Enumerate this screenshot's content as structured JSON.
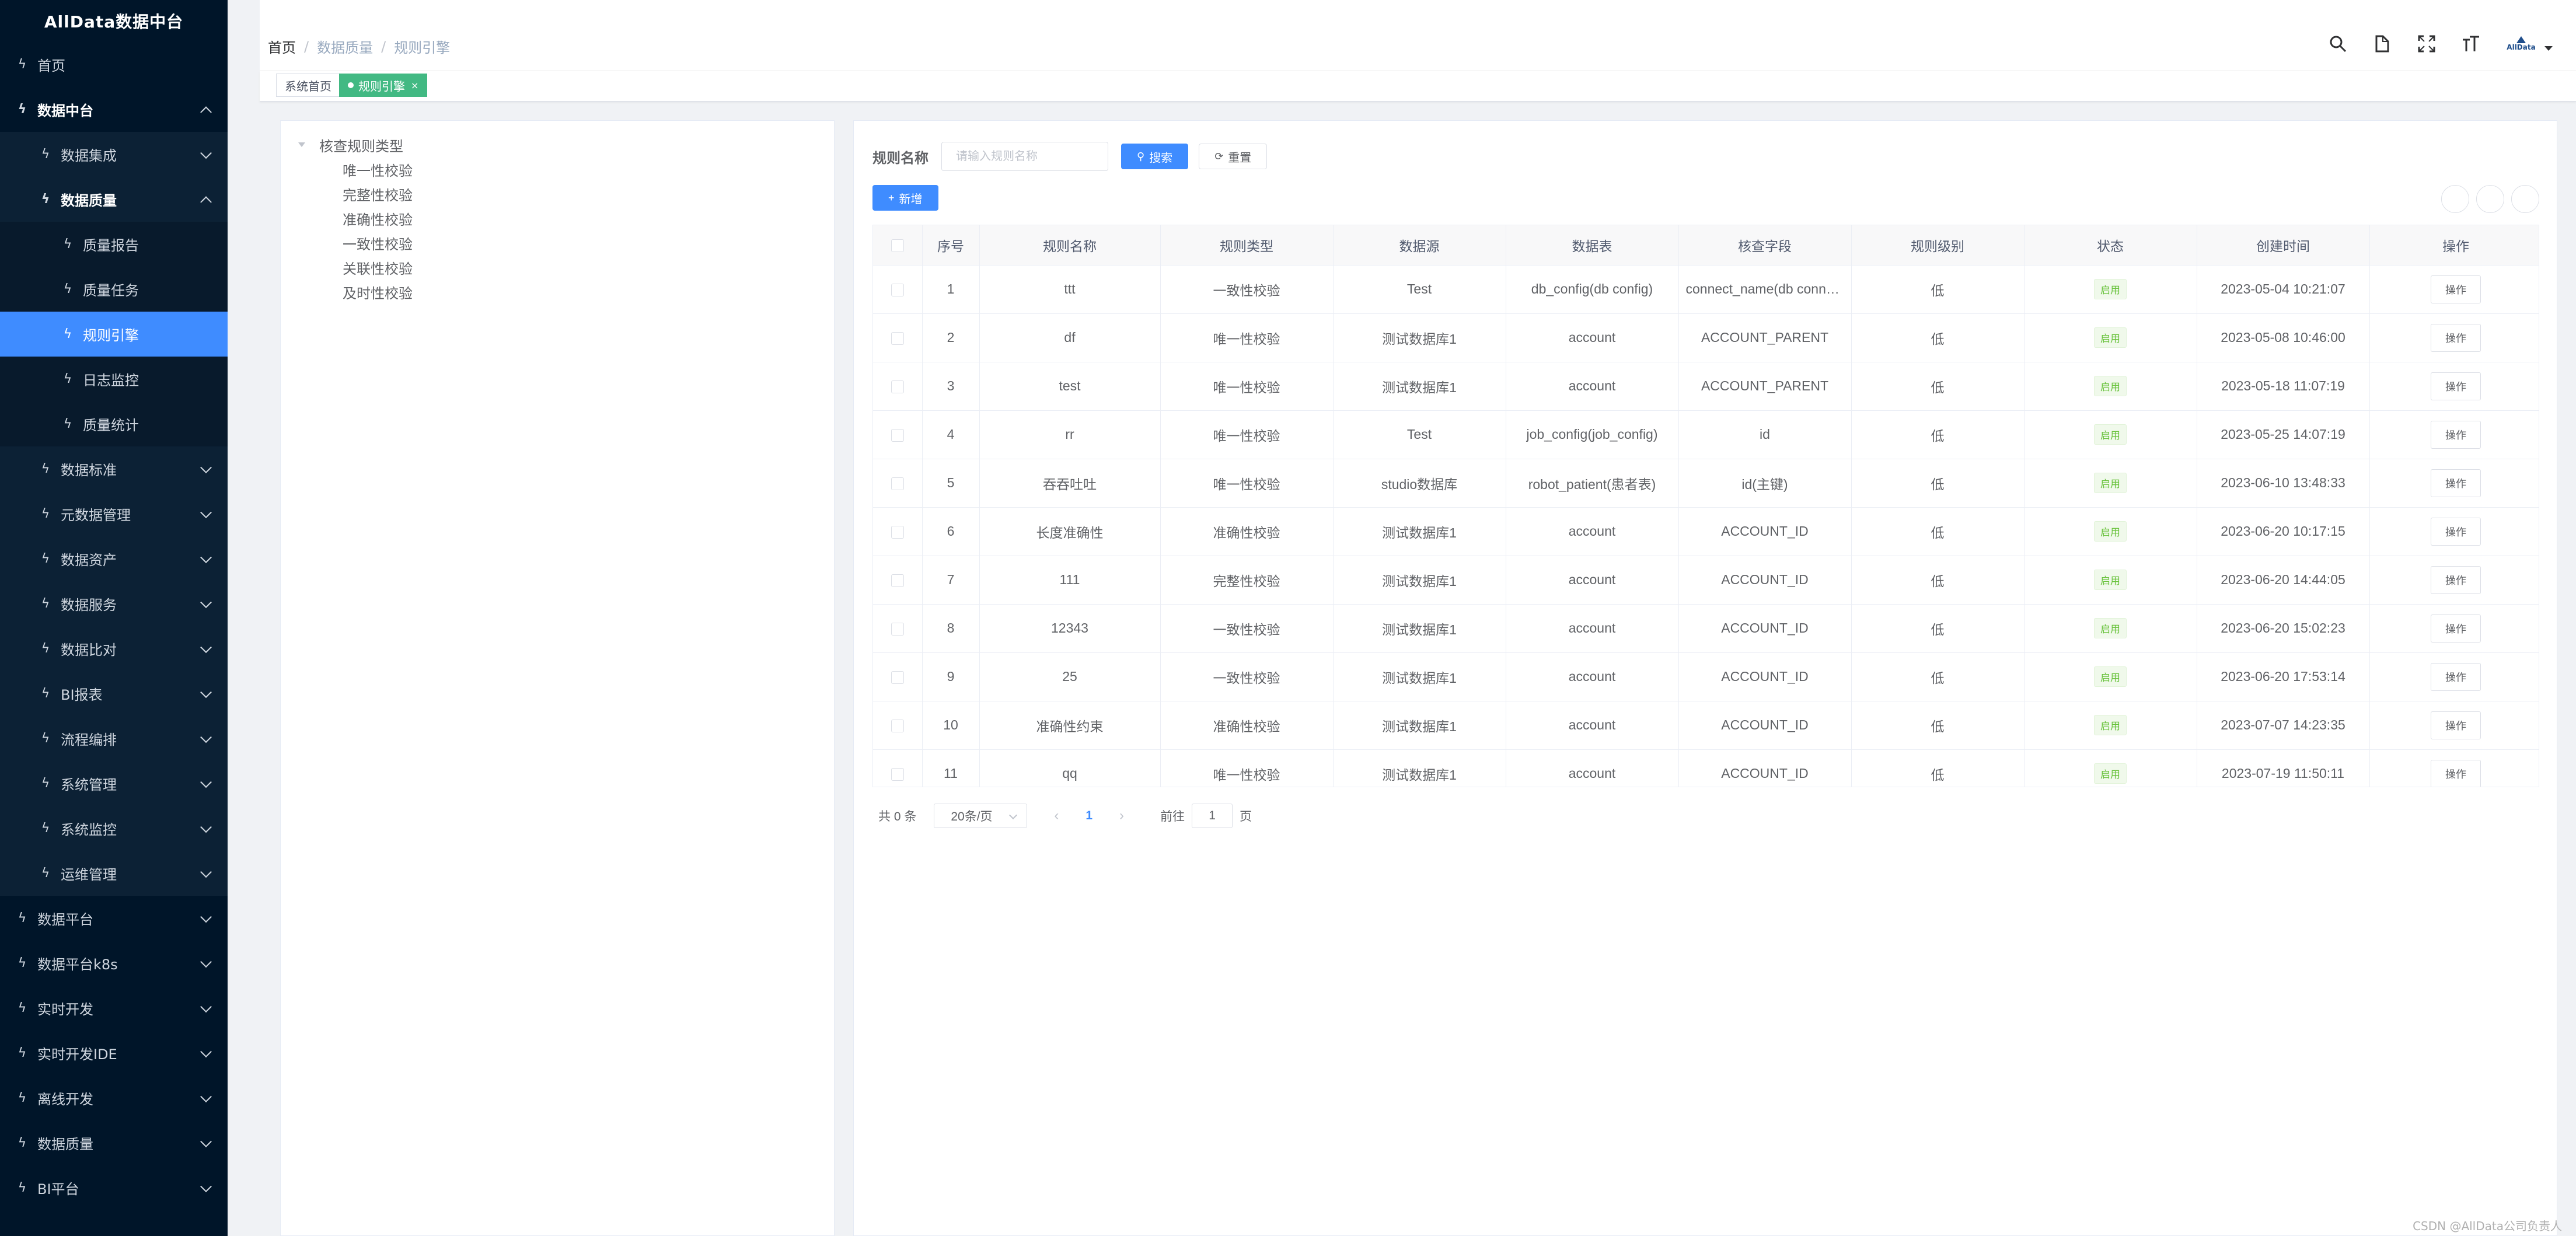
{
  "app_title": "AllData数据中台",
  "sidebar": {
    "items": [
      {
        "label": "首页",
        "level": 0,
        "chev": null,
        "bold": false,
        "active": false
      },
      {
        "label": "数据中台",
        "level": 0,
        "chev": "up",
        "bold": true,
        "active": false
      },
      {
        "label": "数据集成",
        "level": 1,
        "chev": "down",
        "bold": false,
        "active": false
      },
      {
        "label": "数据质量",
        "level": 1,
        "chev": "up",
        "bold": true,
        "active": false
      },
      {
        "label": "质量报告",
        "level": 2,
        "chev": null,
        "bold": false,
        "active": false
      },
      {
        "label": "质量任务",
        "level": 2,
        "chev": null,
        "bold": false,
        "active": false
      },
      {
        "label": "规则引擎",
        "level": 2,
        "chev": null,
        "bold": false,
        "active": true
      },
      {
        "label": "日志监控",
        "level": 2,
        "chev": null,
        "bold": false,
        "active": false
      },
      {
        "label": "质量统计",
        "level": 2,
        "chev": null,
        "bold": false,
        "active": false
      },
      {
        "label": "数据标准",
        "level": 1,
        "chev": "down",
        "bold": false,
        "active": false
      },
      {
        "label": "元数据管理",
        "level": 1,
        "chev": "down",
        "bold": false,
        "active": false
      },
      {
        "label": "数据资产",
        "level": 1,
        "chev": "down",
        "bold": false,
        "active": false
      },
      {
        "label": "数据服务",
        "level": 1,
        "chev": "down",
        "bold": false,
        "active": false
      },
      {
        "label": "数据比对",
        "level": 1,
        "chev": "down",
        "bold": false,
        "active": false
      },
      {
        "label": "BI报表",
        "level": 1,
        "chev": "down",
        "bold": false,
        "active": false
      },
      {
        "label": "流程编排",
        "level": 1,
        "chev": "down",
        "bold": false,
        "active": false
      },
      {
        "label": "系统管理",
        "level": 1,
        "chev": "down",
        "bold": false,
        "active": false
      },
      {
        "label": "系统监控",
        "level": 1,
        "chev": "down",
        "bold": false,
        "active": false
      },
      {
        "label": "运维管理",
        "level": 1,
        "chev": "down",
        "bold": false,
        "active": false
      },
      {
        "label": "数据平台",
        "level": 0,
        "chev": "down",
        "bold": false,
        "active": false
      },
      {
        "label": "数据平台k8s",
        "level": 0,
        "chev": "down",
        "bold": false,
        "active": false
      },
      {
        "label": "实时开发",
        "level": 0,
        "chev": "down",
        "bold": false,
        "active": false
      },
      {
        "label": "实时开发IDE",
        "level": 0,
        "chev": "down",
        "bold": false,
        "active": false
      },
      {
        "label": "离线开发",
        "level": 0,
        "chev": "down",
        "bold": false,
        "active": false
      },
      {
        "label": "数据质量",
        "level": 0,
        "chev": "down",
        "bold": false,
        "active": false
      },
      {
        "label": "BI平台",
        "level": 0,
        "chev": "down",
        "bold": false,
        "active": false
      }
    ]
  },
  "breadcrumb": [
    "首页",
    "数据质量",
    "规则引擎"
  ],
  "header": {
    "icons": [
      "search-icon",
      "document-icon",
      "fullscreen-icon",
      "font-size-icon"
    ],
    "avatar_text": "AllData"
  },
  "tags": [
    {
      "label": "系统首页",
      "active": false
    },
    {
      "label": "规则引擎",
      "active": true
    }
  ],
  "tree": {
    "root": "核查规则类型",
    "children": [
      "唯一性校验",
      "完整性校验",
      "准确性校验",
      "一致性校验",
      "关联性校验",
      "及时性校验"
    ]
  },
  "search": {
    "label": "规则名称",
    "placeholder": "请输入规则名称",
    "search_button": "搜索",
    "reset_button": "重置",
    "add_button": "新增"
  },
  "table": {
    "columns": [
      "序号",
      "规则名称",
      "规则类型",
      "数据源",
      "数据表",
      "核查字段",
      "规则级别",
      "状态",
      "创建时间",
      "操作"
    ],
    "rows": [
      [
        "1",
        "ttt",
        "一致性校验",
        "Test",
        "db_config(db config)",
        "connect_name(db connect name)",
        "低",
        "启用",
        "2023-05-04 10:21:07",
        "操作"
      ],
      [
        "2",
        "df",
        "唯一性校验",
        "测试数据库1",
        "account",
        "ACCOUNT_PARENT",
        "低",
        "启用",
        "2023-05-08 10:46:00",
        "操作"
      ],
      [
        "3",
        "test",
        "唯一性校验",
        "测试数据库1",
        "account",
        "ACCOUNT_PARENT",
        "低",
        "启用",
        "2023-05-18 11:07:19",
        "操作"
      ],
      [
        "4",
        "rr",
        "唯一性校验",
        "Test",
        "job_config(job_config)",
        "id",
        "低",
        "启用",
        "2023-05-25 14:07:19",
        "操作"
      ],
      [
        "5",
        "吞吞吐吐",
        "唯一性校验",
        "studio数据库",
        "robot_patient(患者表)",
        "id(主键)",
        "低",
        "启用",
        "2023-06-10 13:48:33",
        "操作"
      ],
      [
        "6",
        "长度准确性",
        "准确性校验",
        "测试数据库1",
        "account",
        "ACCOUNT_ID",
        "低",
        "启用",
        "2023-06-20 10:17:15",
        "操作"
      ],
      [
        "7",
        "111",
        "完整性校验",
        "测试数据库1",
        "account",
        "ACCOUNT_ID",
        "低",
        "启用",
        "2023-06-20 14:44:05",
        "操作"
      ],
      [
        "8",
        "12343",
        "一致性校验",
        "测试数据库1",
        "account",
        "ACCOUNT_ID",
        "低",
        "启用",
        "2023-06-20 15:02:23",
        "操作"
      ],
      [
        "9",
        "25",
        "一致性校验",
        "测试数据库1",
        "account",
        "ACCOUNT_ID",
        "低",
        "启用",
        "2023-06-20 17:53:14",
        "操作"
      ],
      [
        "10",
        "准确性约束",
        "准确性校验",
        "测试数据库1",
        "account",
        "ACCOUNT_ID",
        "低",
        "启用",
        "2023-07-07 14:23:35",
        "操作"
      ],
      [
        "11",
        "qq",
        "唯一性校验",
        "测试数据库1",
        "account",
        "ACCOUNT_ID",
        "低",
        "启用",
        "2023-07-19 11:50:11",
        "操作"
      ]
    ]
  },
  "pagination": {
    "total_text": "共 0 条",
    "page_size": "20条/页",
    "current_page": "1",
    "goto_prefix": "前往",
    "goto_value": "1",
    "goto_suffix": "页"
  },
  "watermark": "CSDN @AllData公司负责人"
}
